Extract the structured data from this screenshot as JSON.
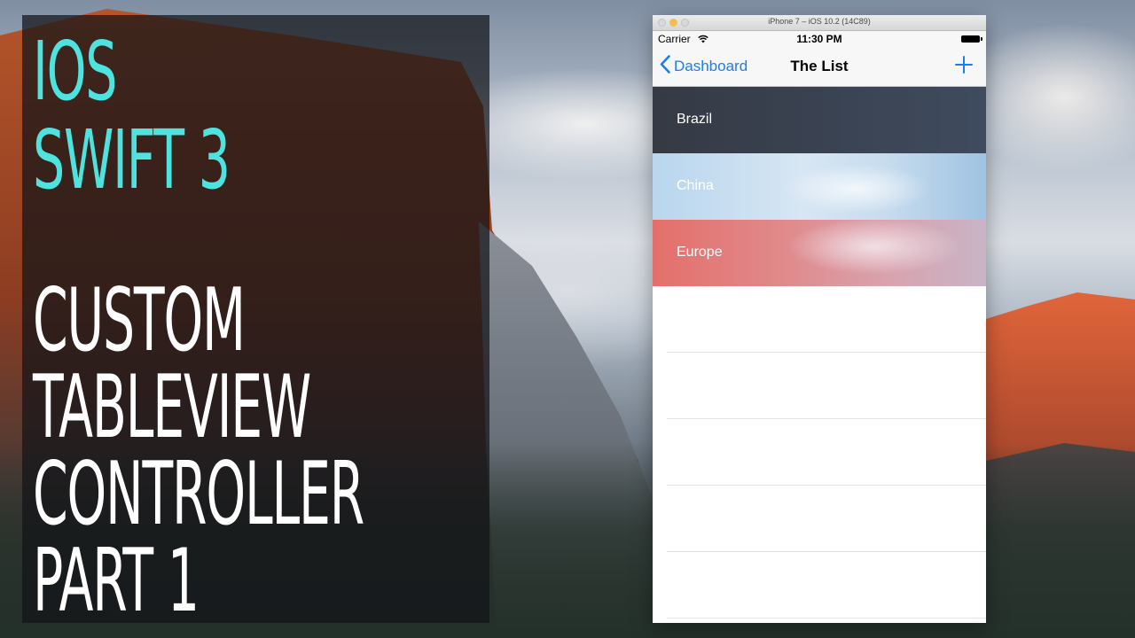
{
  "overlay": {
    "lines": [
      {
        "text": "IOS",
        "style": "accent"
      },
      {
        "text": "SWIFT 3",
        "style": "accent"
      },
      {
        "text": "CUSTOM",
        "style": "white"
      },
      {
        "text": "TABLEVIEW",
        "style": "white"
      },
      {
        "text": "CONTROLLER",
        "style": "white"
      },
      {
        "text": "PART 1",
        "style": "white"
      }
    ],
    "accent_color": "#4fe3e0"
  },
  "simulator": {
    "window_title": "iPhone 7 – iOS 10.2 (14C89)",
    "status_bar": {
      "carrier": "Carrier",
      "time": "11:30 PM",
      "icons": [
        "wifi-icon",
        "battery-icon"
      ]
    },
    "nav_bar": {
      "back_label": "Dashboard",
      "title": "The List",
      "add_icon": "plus-icon",
      "tint_color": "#1b7cf3"
    },
    "rows": [
      {
        "label": "Brazil"
      },
      {
        "label": "China"
      },
      {
        "label": "Europe"
      }
    ],
    "empty_row_count": 5
  }
}
